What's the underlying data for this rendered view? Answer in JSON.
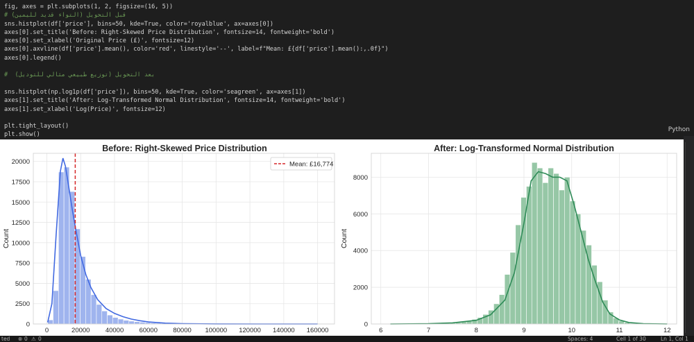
{
  "code": {
    "lines": [
      [
        {
          "t": "fig, axes = plt.subplots(1, 2, figsize=(16, 5))",
          "c": "#d4d4d4"
        }
      ],
      [
        {
          "t": "# ",
          "c": "#6a9955"
        },
        {
          "t": "قبل التحويل (التواء قديد لليمين)",
          "c": "#6a9955"
        }
      ],
      [
        {
          "t": "sns.histplot(df['price'], bins=50, kde=True, color='royalblue', ax=axes[0])",
          "c": "#d4d4d4"
        }
      ],
      [
        {
          "t": "axes[0].set_title('Before: Right-Skewed Price Distribution', fontsize=14, fontweight='bold')",
          "c": "#d4d4d4"
        }
      ],
      [
        {
          "t": "axes[0].set_xlabel('Original Price (£)', fontsize=12)",
          "c": "#d4d4d4"
        }
      ],
      [
        {
          "t": "axes[0].axvline(df['price'].mean(), color='red', linestyle='--', label=f\"Mean: £{df['price'].mean():,.0f}\")",
          "c": "#d4d4d4"
        }
      ],
      [
        {
          "t": "axes[0].legend()",
          "c": "#d4d4d4"
        }
      ],
      [
        {
          "t": "",
          "c": "#d4d4d4"
        }
      ],
      [
        {
          "t": "#  ",
          "c": "#6a9955"
        },
        {
          "t": "بعد التحويل (توزيع طبيعي مثالي للتوديل)",
          "c": "#6a9955"
        }
      ],
      [
        {
          "t": "",
          "c": "#d4d4d4"
        }
      ],
      [
        {
          "t": "sns.histplot(np.log1p(df['price']), bins=50, kde=True, color='seagreen', ax=axes[1])",
          "c": "#d4d4d4"
        }
      ],
      [
        {
          "t": "axes[1].set_title('After: Log-Transformed Normal Distribution', fontsize=14, fontweight='bold')",
          "c": "#d4d4d4"
        }
      ],
      [
        {
          "t": "axes[1].set_xlabel('Log(Price)', fontsize=12)",
          "c": "#d4d4d4"
        }
      ],
      [
        {
          "t": "",
          "c": "#d4d4d4"
        }
      ],
      [
        {
          "t": "plt.tight_layout()",
          "c": "#d4d4d4"
        }
      ],
      [
        {
          "t": "plt.show()",
          "c": "#d4d4d4"
        }
      ]
    ]
  },
  "cell": {
    "language": "Python"
  },
  "status": {
    "left": "ted",
    "errors": "0",
    "warnings": "0",
    "spaces": "Spaces: 4",
    "cell_info": "Cell 1 of 30",
    "position": "Ln 1, Col 1"
  },
  "chart_data": [
    {
      "type": "bar",
      "title": "Before: Right-Skewed Price Distribution",
      "ylabel": "Count",
      "xlabel": "",
      "color": "#4169e1",
      "bar_color": "#9fb4ee",
      "xlim": [
        -8000,
        170000
      ],
      "ylim": [
        0,
        21000
      ],
      "xticks": [
        0,
        20000,
        40000,
        60000,
        80000,
        100000,
        120000,
        140000,
        160000
      ],
      "yticks": [
        0,
        2500,
        5000,
        7500,
        10000,
        12500,
        15000,
        17500,
        20000
      ],
      "bin_start": 500,
      "bin_width": 3200,
      "values": [
        500,
        4100,
        18700,
        19300,
        16300,
        11700,
        8300,
        5500,
        3600,
        2400,
        1600,
        1100,
        800,
        600,
        450,
        350,
        280,
        220,
        170,
        130,
        100,
        80,
        60,
        50,
        40,
        30,
        25,
        20,
        15,
        12,
        10,
        8,
        6,
        5,
        4,
        3,
        3,
        2,
        2,
        2,
        1,
        1,
        1,
        1,
        1,
        0,
        0,
        0,
        0,
        1
      ],
      "kde": [
        [
          500,
          200
        ],
        [
          3000,
          2500
        ],
        [
          5500,
          11000
        ],
        [
          8000,
          18800
        ],
        [
          9500,
          20400
        ],
        [
          11000,
          19400
        ],
        [
          13000,
          16800
        ],
        [
          15000,
          14100
        ],
        [
          17000,
          11700
        ],
        [
          20000,
          8400
        ],
        [
          23000,
          6100
        ],
        [
          26000,
          4500
        ],
        [
          30000,
          3000
        ],
        [
          35000,
          1900
        ],
        [
          40000,
          1300
        ],
        [
          45000,
          900
        ],
        [
          50000,
          600
        ],
        [
          55000,
          400
        ],
        [
          60000,
          250
        ],
        [
          70000,
          100
        ],
        [
          80000,
          40
        ],
        [
          100000,
          10
        ],
        [
          130000,
          0
        ],
        [
          160000,
          0
        ]
      ],
      "reference_line": {
        "x": 16774,
        "color": "#d62728",
        "label": "Mean: £16,774"
      },
      "legend": "top-right",
      "grid": true
    },
    {
      "type": "bar",
      "title": "After: Log-Transformed Normal Distribution",
      "ylabel": "Count",
      "xlabel": "",
      "color": "#2e8b57",
      "bar_color": "#96c7a6",
      "xlim": [
        5.8,
        12.2
      ],
      "ylim": [
        0,
        9300
      ],
      "xticks": [
        6,
        7,
        8,
        9,
        10,
        11,
        12
      ],
      "yticks": [
        0,
        2000,
        4000,
        6000,
        8000
      ],
      "bin_start": 6.2,
      "bin_width": 0.114,
      "values": [
        2,
        3,
        5,
        6,
        8,
        10,
        12,
        15,
        20,
        30,
        45,
        60,
        80,
        120,
        170,
        250,
        350,
        520,
        750,
        1100,
        1600,
        2700,
        3900,
        5400,
        6900,
        7500,
        8800,
        8500,
        7700,
        8500,
        8200,
        7300,
        8000,
        6700,
        6000,
        5100,
        4300,
        3200,
        2300,
        1300,
        650,
        330,
        160,
        80,
        40,
        20,
        10,
        5,
        3,
        2
      ],
      "kde": [
        [
          6.2,
          0
        ],
        [
          7.0,
          20
        ],
        [
          7.5,
          60
        ],
        [
          8.0,
          200
        ],
        [
          8.3,
          500
        ],
        [
          8.6,
          1300
        ],
        [
          8.8,
          2800
        ],
        [
          9.0,
          5500
        ],
        [
          9.15,
          7800
        ],
        [
          9.3,
          8300
        ],
        [
          9.45,
          8200
        ],
        [
          9.6,
          8000
        ],
        [
          9.75,
          8000
        ],
        [
          9.9,
          7800
        ],
        [
          10.05,
          6500
        ],
        [
          10.2,
          5000
        ],
        [
          10.35,
          3500
        ],
        [
          10.5,
          2300
        ],
        [
          10.65,
          1200
        ],
        [
          10.8,
          550
        ],
        [
          11.0,
          220
        ],
        [
          11.2,
          80
        ],
        [
          11.5,
          20
        ],
        [
          12.0,
          0
        ]
      ],
      "legend": "none",
      "grid": true
    }
  ]
}
